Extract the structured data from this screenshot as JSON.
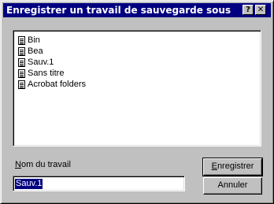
{
  "window": {
    "title": "Enregistrer un travail de sauvegarde sous",
    "help_label": "?",
    "close_label": "✕"
  },
  "file_list": {
    "items": [
      {
        "label": "Bin",
        "icon": "document-icon"
      },
      {
        "label": "Bea",
        "icon": "document-icon"
      },
      {
        "label": "Sauv.1",
        "icon": "document-icon"
      },
      {
        "label": "Sans titre",
        "icon": "document-icon"
      },
      {
        "label": "Acrobat folders",
        "icon": "document-icon"
      }
    ]
  },
  "job_name": {
    "label_accel": "N",
    "label_rest": "om du travail",
    "value": "Sauv.1"
  },
  "buttons": {
    "save_accel": "E",
    "save_rest": "nregistrer",
    "cancel": "Annuler"
  },
  "colors": {
    "titlebar": "#000080",
    "face": "#c0c0c0",
    "selection": "#000080"
  }
}
